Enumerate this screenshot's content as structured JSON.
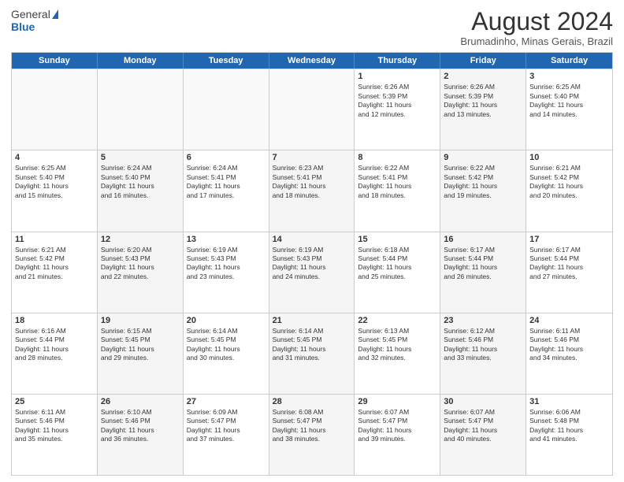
{
  "header": {
    "logo_general": "General",
    "logo_blue": "Blue",
    "month_title": "August 2024",
    "subtitle": "Brumadinho, Minas Gerais, Brazil"
  },
  "weekdays": [
    "Sunday",
    "Monday",
    "Tuesday",
    "Wednesday",
    "Thursday",
    "Friday",
    "Saturday"
  ],
  "rows": [
    [
      {
        "day": "",
        "info": "",
        "empty": true
      },
      {
        "day": "",
        "info": "",
        "empty": true
      },
      {
        "day": "",
        "info": "",
        "empty": true
      },
      {
        "day": "",
        "info": "",
        "empty": true
      },
      {
        "day": "1",
        "info": "Sunrise: 6:26 AM\nSunset: 5:39 PM\nDaylight: 11 hours\nand 12 minutes.",
        "empty": false
      },
      {
        "day": "2",
        "info": "Sunrise: 6:26 AM\nSunset: 5:39 PM\nDaylight: 11 hours\nand 13 minutes.",
        "empty": false
      },
      {
        "day": "3",
        "info": "Sunrise: 6:25 AM\nSunset: 5:40 PM\nDaylight: 11 hours\nand 14 minutes.",
        "empty": false
      }
    ],
    [
      {
        "day": "4",
        "info": "Sunrise: 6:25 AM\nSunset: 5:40 PM\nDaylight: 11 hours\nand 15 minutes.",
        "empty": false
      },
      {
        "day": "5",
        "info": "Sunrise: 6:24 AM\nSunset: 5:40 PM\nDaylight: 11 hours\nand 16 minutes.",
        "empty": false
      },
      {
        "day": "6",
        "info": "Sunrise: 6:24 AM\nSunset: 5:41 PM\nDaylight: 11 hours\nand 17 minutes.",
        "empty": false
      },
      {
        "day": "7",
        "info": "Sunrise: 6:23 AM\nSunset: 5:41 PM\nDaylight: 11 hours\nand 18 minutes.",
        "empty": false
      },
      {
        "day": "8",
        "info": "Sunrise: 6:22 AM\nSunset: 5:41 PM\nDaylight: 11 hours\nand 18 minutes.",
        "empty": false
      },
      {
        "day": "9",
        "info": "Sunrise: 6:22 AM\nSunset: 5:42 PM\nDaylight: 11 hours\nand 19 minutes.",
        "empty": false
      },
      {
        "day": "10",
        "info": "Sunrise: 6:21 AM\nSunset: 5:42 PM\nDaylight: 11 hours\nand 20 minutes.",
        "empty": false
      }
    ],
    [
      {
        "day": "11",
        "info": "Sunrise: 6:21 AM\nSunset: 5:42 PM\nDaylight: 11 hours\nand 21 minutes.",
        "empty": false
      },
      {
        "day": "12",
        "info": "Sunrise: 6:20 AM\nSunset: 5:43 PM\nDaylight: 11 hours\nand 22 minutes.",
        "empty": false
      },
      {
        "day": "13",
        "info": "Sunrise: 6:19 AM\nSunset: 5:43 PM\nDaylight: 11 hours\nand 23 minutes.",
        "empty": false
      },
      {
        "day": "14",
        "info": "Sunrise: 6:19 AM\nSunset: 5:43 PM\nDaylight: 11 hours\nand 24 minutes.",
        "empty": false
      },
      {
        "day": "15",
        "info": "Sunrise: 6:18 AM\nSunset: 5:44 PM\nDaylight: 11 hours\nand 25 minutes.",
        "empty": false
      },
      {
        "day": "16",
        "info": "Sunrise: 6:17 AM\nSunset: 5:44 PM\nDaylight: 11 hours\nand 26 minutes.",
        "empty": false
      },
      {
        "day": "17",
        "info": "Sunrise: 6:17 AM\nSunset: 5:44 PM\nDaylight: 11 hours\nand 27 minutes.",
        "empty": false
      }
    ],
    [
      {
        "day": "18",
        "info": "Sunrise: 6:16 AM\nSunset: 5:44 PM\nDaylight: 11 hours\nand 28 minutes.",
        "empty": false
      },
      {
        "day": "19",
        "info": "Sunrise: 6:15 AM\nSunset: 5:45 PM\nDaylight: 11 hours\nand 29 minutes.",
        "empty": false
      },
      {
        "day": "20",
        "info": "Sunrise: 6:14 AM\nSunset: 5:45 PM\nDaylight: 11 hours\nand 30 minutes.",
        "empty": false
      },
      {
        "day": "21",
        "info": "Sunrise: 6:14 AM\nSunset: 5:45 PM\nDaylight: 11 hours\nand 31 minutes.",
        "empty": false
      },
      {
        "day": "22",
        "info": "Sunrise: 6:13 AM\nSunset: 5:45 PM\nDaylight: 11 hours\nand 32 minutes.",
        "empty": false
      },
      {
        "day": "23",
        "info": "Sunrise: 6:12 AM\nSunset: 5:46 PM\nDaylight: 11 hours\nand 33 minutes.",
        "empty": false
      },
      {
        "day": "24",
        "info": "Sunrise: 6:11 AM\nSunset: 5:46 PM\nDaylight: 11 hours\nand 34 minutes.",
        "empty": false
      }
    ],
    [
      {
        "day": "25",
        "info": "Sunrise: 6:11 AM\nSunset: 5:46 PM\nDaylight: 11 hours\nand 35 minutes.",
        "empty": false
      },
      {
        "day": "26",
        "info": "Sunrise: 6:10 AM\nSunset: 5:46 PM\nDaylight: 11 hours\nand 36 minutes.",
        "empty": false
      },
      {
        "day": "27",
        "info": "Sunrise: 6:09 AM\nSunset: 5:47 PM\nDaylight: 11 hours\nand 37 minutes.",
        "empty": false
      },
      {
        "day": "28",
        "info": "Sunrise: 6:08 AM\nSunset: 5:47 PM\nDaylight: 11 hours\nand 38 minutes.",
        "empty": false
      },
      {
        "day": "29",
        "info": "Sunrise: 6:07 AM\nSunset: 5:47 PM\nDaylight: 11 hours\nand 39 minutes.",
        "empty": false
      },
      {
        "day": "30",
        "info": "Sunrise: 6:07 AM\nSunset: 5:47 PM\nDaylight: 11 hours\nand 40 minutes.",
        "empty": false
      },
      {
        "day": "31",
        "info": "Sunrise: 6:06 AM\nSunset: 5:48 PM\nDaylight: 11 hours\nand 41 minutes.",
        "empty": false
      }
    ]
  ]
}
